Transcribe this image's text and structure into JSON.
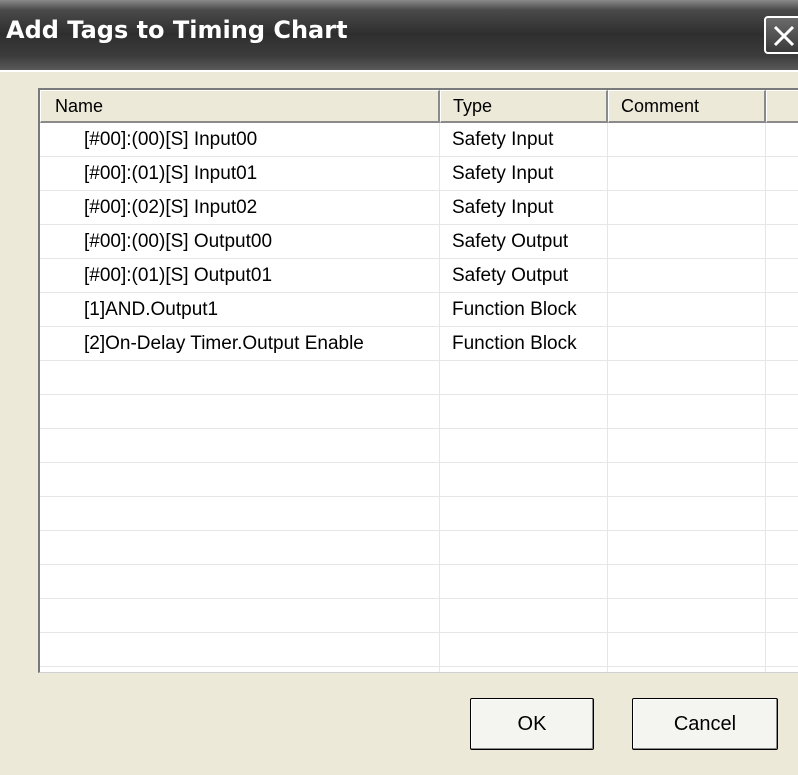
{
  "window": {
    "title": "Add Tags to Timing Chart",
    "close_icon": "close-x-icon"
  },
  "list": {
    "columns": [
      "Name",
      "Type",
      "Comment",
      ""
    ],
    "rows": [
      {
        "name": "[#00]:(00)[S] Input00",
        "type": "Safety Input",
        "comment": ""
      },
      {
        "name": "[#00]:(01)[S] Input01",
        "type": "Safety Input",
        "comment": ""
      },
      {
        "name": "[#00]:(02)[S] Input02",
        "type": "Safety Input",
        "comment": ""
      },
      {
        "name": "[#00]:(00)[S] Output00",
        "type": "Safety Output",
        "comment": ""
      },
      {
        "name": "[#00]:(01)[S] Output01",
        "type": "Safety Output",
        "comment": ""
      },
      {
        "name": "[1]AND.Output1",
        "type": "Function Block",
        "comment": ""
      },
      {
        "name": "[2]On-Delay Timer.Output Enable",
        "type": "Function Block",
        "comment": ""
      },
      {
        "name": "",
        "type": "",
        "comment": ""
      },
      {
        "name": "",
        "type": "",
        "comment": ""
      },
      {
        "name": "",
        "type": "",
        "comment": ""
      },
      {
        "name": "",
        "type": "",
        "comment": ""
      },
      {
        "name": "",
        "type": "",
        "comment": ""
      },
      {
        "name": "",
        "type": "",
        "comment": ""
      },
      {
        "name": "",
        "type": "",
        "comment": ""
      },
      {
        "name": "",
        "type": "",
        "comment": ""
      },
      {
        "name": "",
        "type": "",
        "comment": ""
      }
    ]
  },
  "buttons": {
    "ok": "OK",
    "cancel": "Cancel"
  }
}
